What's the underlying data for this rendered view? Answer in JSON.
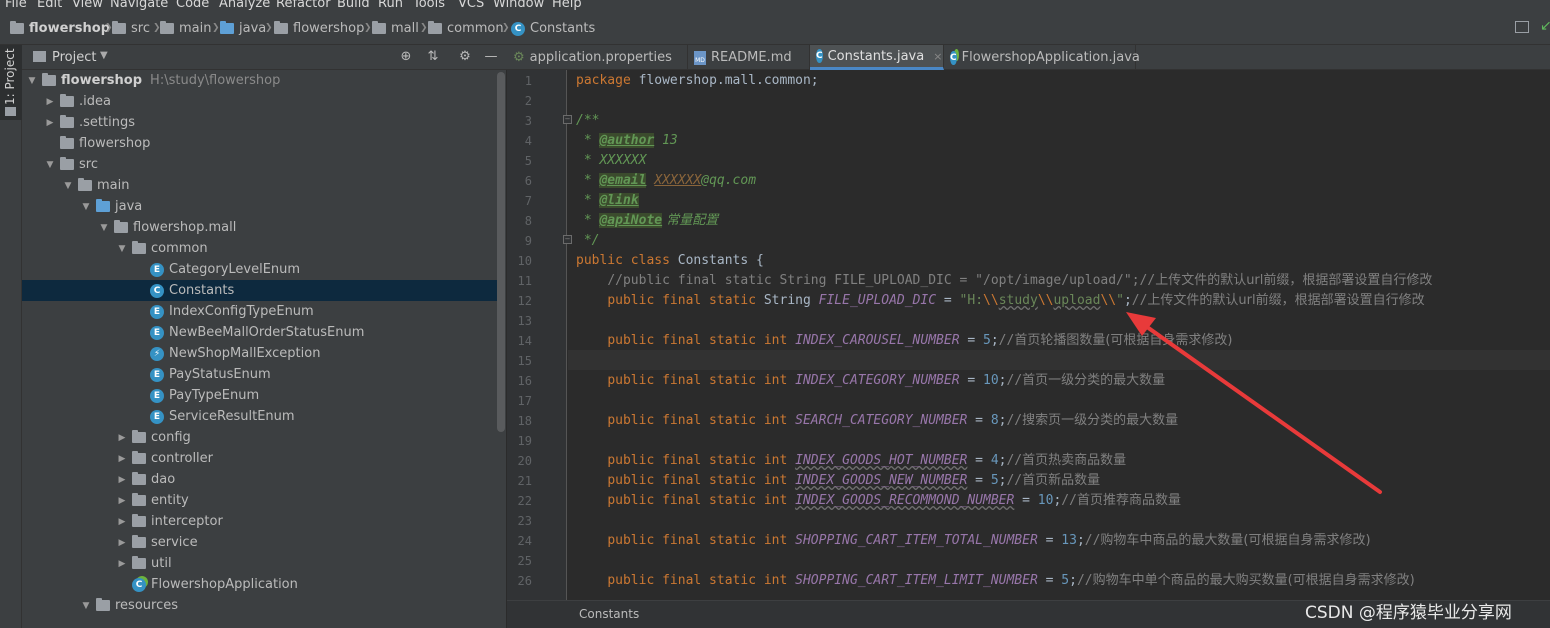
{
  "menu": [
    "File",
    "Edit",
    "View",
    "Navigate",
    "Code",
    "Analyze",
    "Refactor",
    "Build",
    "Run",
    "Tools",
    "VCS",
    "Window",
    "Help"
  ],
  "breadcrumb": [
    "flowershop",
    "src",
    "main",
    "java",
    "flowershop",
    "mall",
    "common",
    "Constants"
  ],
  "left_strip": {
    "project_tab_label": "1: Project"
  },
  "project_panel": {
    "title": "Project",
    "tree": [
      {
        "label": "flowershop",
        "path": "H:\\study\\flowershop",
        "depth": 0,
        "arrow": "open",
        "icon": "folder-icon",
        "root": true
      },
      {
        "label": ".idea",
        "depth": 1,
        "arrow": "closed",
        "icon": "folder-icon"
      },
      {
        "label": ".settings",
        "depth": 1,
        "arrow": "closed",
        "icon": "folder-icon"
      },
      {
        "label": "flowershop",
        "depth": 1,
        "arrow": "none",
        "icon": "folder-icon"
      },
      {
        "label": "src",
        "depth": 1,
        "arrow": "open",
        "icon": "folder-icon"
      },
      {
        "label": "main",
        "depth": 2,
        "arrow": "open",
        "icon": "folder-icon"
      },
      {
        "label": "java",
        "depth": 3,
        "arrow": "open",
        "icon": "source-folder-icon"
      },
      {
        "label": "flowershop.mall",
        "depth": 4,
        "arrow": "open",
        "icon": "package-icon"
      },
      {
        "label": "common",
        "depth": 5,
        "arrow": "open",
        "icon": "package-icon"
      },
      {
        "label": "CategoryLevelEnum",
        "depth": 6,
        "arrow": "none",
        "icon": "enum-icon"
      },
      {
        "label": "Constants",
        "depth": 6,
        "arrow": "none",
        "icon": "class-icon",
        "selected": true
      },
      {
        "label": "IndexConfigTypeEnum",
        "depth": 6,
        "arrow": "none",
        "icon": "enum-icon"
      },
      {
        "label": "NewBeeMallOrderStatusEnum",
        "depth": 6,
        "arrow": "none",
        "icon": "enum-icon"
      },
      {
        "label": "NewShopMallException",
        "depth": 6,
        "arrow": "none",
        "icon": "exception-class-icon"
      },
      {
        "label": "PayStatusEnum",
        "depth": 6,
        "arrow": "none",
        "icon": "enum-icon"
      },
      {
        "label": "PayTypeEnum",
        "depth": 6,
        "arrow": "none",
        "icon": "enum-icon"
      },
      {
        "label": "ServiceResultEnum",
        "depth": 6,
        "arrow": "none",
        "icon": "enum-icon"
      },
      {
        "label": "config",
        "depth": 5,
        "arrow": "closed",
        "icon": "package-icon"
      },
      {
        "label": "controller",
        "depth": 5,
        "arrow": "closed",
        "icon": "package-icon"
      },
      {
        "label": "dao",
        "depth": 5,
        "arrow": "closed",
        "icon": "package-icon"
      },
      {
        "label": "entity",
        "depth": 5,
        "arrow": "closed",
        "icon": "package-icon"
      },
      {
        "label": "interceptor",
        "depth": 5,
        "arrow": "closed",
        "icon": "package-icon"
      },
      {
        "label": "service",
        "depth": 5,
        "arrow": "closed",
        "icon": "package-icon"
      },
      {
        "label": "util",
        "depth": 5,
        "arrow": "closed",
        "icon": "package-icon"
      },
      {
        "label": "FlowershopApplication",
        "depth": 5,
        "arrow": "none",
        "icon": "spring-boot-class-icon"
      },
      {
        "label": "resources",
        "depth": 3,
        "arrow": "open",
        "icon": "resources-folder-icon"
      }
    ]
  },
  "tabs": [
    {
      "label": "application.properties",
      "icon": "properties-icon"
    },
    {
      "label": "README.md",
      "icon": "markdown-icon"
    },
    {
      "label": "Constants.java",
      "icon": "class-icon",
      "active": true
    },
    {
      "label": "FlowershopApplication.java",
      "icon": "spring-boot-class-icon"
    }
  ],
  "editor": {
    "current_line": 15,
    "lines": [
      {
        "n": "1",
        "html": "<span class='kw'>package</span> flowershop.mall.common;"
      },
      {
        "n": "2",
        "html": ""
      },
      {
        "n": "3",
        "html": "<span class='doc'>/**</span>"
      },
      {
        "n": "4",
        "html": "<span class='doc'> * </span><span class='tag'>@author</span><span class='doc'> 13</span>"
      },
      {
        "n": "5",
        "html": "<span class='doc'> * XXXXXX</span>"
      },
      {
        "n": "6",
        "html": "<span class='doc'> * </span><span class='tag'>@email</span><span class='doc'> </span><span class='docv' style='text-decoration:underline'>XXXXXX</span><span class='doc'>@qq.com</span>"
      },
      {
        "n": "7",
        "html": "<span class='doc'> * </span><span class='tag'>@link</span>"
      },
      {
        "n": "8",
        "html": "<span class='doc'> * </span><span class='tag'>@apiNote</span><span class='doc cjk'> 常量配置</span>"
      },
      {
        "n": "9",
        "html": "<span class='doc'> */</span>"
      },
      {
        "n": "10",
        "html": "<span class='kw'>public class</span> Constants {"
      },
      {
        "n": "11",
        "html": "    <span class='cm'>//public final static String FILE_UPLOAD_DIC = \"/opt/image/upload/\";//<span class='cjk'>上传文件的默认url前缀，根据部署设置自行修改</span></span>"
      },
      {
        "n": "12",
        "html": "    <span class='kw'>public final static</span> String <span class='cn'>FILE_UPLOAD_DIC</span> = <span class='str'>\"H:</span><span class='esc'>\\\\</span><span class='strw'>study</span><span class='esc'>\\\\</span><span class='strw'>upload</span><span class='esc'>\\\\</span><span class='str'>\"</span>;<span class='cm'>//<span class='cjk'>上传文件的默认url前缀，根据部署设置自行修改</span></span>"
      },
      {
        "n": "13",
        "html": ""
      },
      {
        "n": "14",
        "html": "    <span class='kw'>public final static int</span> <span class='cn'>INDEX_CAROUSEL_NUMBER</span> = <span class='num'>5</span>;<span class='cm'>//<span class='cjk'>首页轮播图数量(可根据自身需求修改)</span></span>"
      },
      {
        "n": "15",
        "html": ""
      },
      {
        "n": "16",
        "html": "    <span class='kw'>public final static int</span> <span class='cn'>INDEX_CATEGORY_NUMBER</span> = <span class='num'>10</span>;<span class='cm'>//<span class='cjk'>首页一级分类的最大数量</span></span>"
      },
      {
        "n": "17",
        "html": ""
      },
      {
        "n": "18",
        "html": "    <span class='kw'>public final static int</span> <span class='cn'>SEARCH_CATEGORY_NUMBER</span> = <span class='num'>8</span>;<span class='cm'>//<span class='cjk'>搜索页一级分类的最大数量</span></span>"
      },
      {
        "n": "19",
        "html": ""
      },
      {
        "n": "20",
        "html": "    <span class='kw'>public final static int</span> <span class='cnu'>INDEX_GOODS_HOT_NUMBER</span> = <span class='num'>4</span>;<span class='cm'>//<span class='cjk'>首页热卖商品数量</span></span>"
      },
      {
        "n": "21",
        "html": "    <span class='kw'>public final static int</span> <span class='cnu'>INDEX_GOODS_NEW_NUMBER</span> = <span class='num'>5</span>;<span class='cm'>//<span class='cjk'>首页新品数量</span></span>"
      },
      {
        "n": "22",
        "html": "    <span class='kw'>public final static int</span> <span class='cnu'>INDEX_GOODS_RECOMMOND_NUMBER</span> = <span class='num'>10</span>;<span class='cm'>//<span class='cjk'>首页推荐商品数量</span></span>"
      },
      {
        "n": "23",
        "html": ""
      },
      {
        "n": "24",
        "html": "    <span class='kw'>public final static int</span> <span class='cn'>SHOPPING_CART_ITEM_TOTAL_NUMBER</span> = <span class='num'>13</span>;<span class='cm'>//<span class='cjk'>购物车中商品的最大数量(可根据自身需求修改)</span></span>"
      },
      {
        "n": "25",
        "html": ""
      },
      {
        "n": "26",
        "html": "    <span class='kw'>public final static int</span> <span class='cn'>SHOPPING_CART_ITEM_LIMIT_NUMBER</span> = <span class='num'>5</span>;<span class='cm'>//<span class='cjk'>购物车中单个商品的最大购买数量(可根据自身需求修改)</span></span>"
      }
    ]
  },
  "editor_breadcrumb": "Constants",
  "watermark": "CSDN @程序猿毕业分享网",
  "colors": {
    "background": "#2b2b2b",
    "panel": "#3c3f41",
    "selection": "#0d293e",
    "keyword": "#cc7832",
    "annotation_arrow": "#e83a3a"
  }
}
